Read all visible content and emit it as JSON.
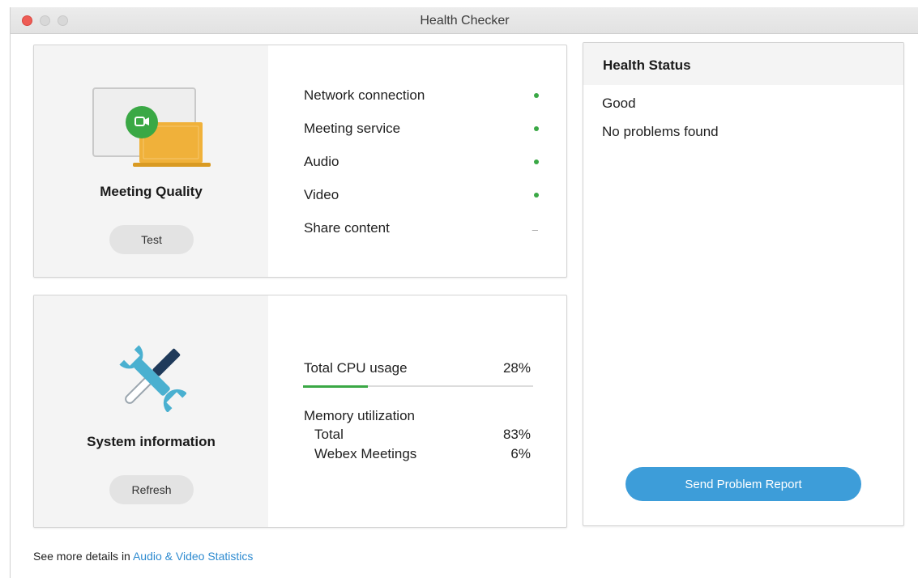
{
  "window": {
    "title": "Health Checker"
  },
  "meeting_quality": {
    "title": "Meeting Quality",
    "button_label": "Test",
    "checks": [
      {
        "label": "Network connection",
        "status": "ok"
      },
      {
        "label": "Meeting service",
        "status": "ok"
      },
      {
        "label": "Audio",
        "status": "ok"
      },
      {
        "label": "Video",
        "status": "ok"
      },
      {
        "label": "Share content",
        "status": "none",
        "status_text": "–"
      }
    ]
  },
  "system_info": {
    "title": "System information",
    "button_label": "Refresh",
    "cpu": {
      "label": "Total CPU usage",
      "value": "28%",
      "fraction": 0.28
    },
    "memory": {
      "heading": "Memory utilization",
      "total_label": "Total",
      "total_value": "83%",
      "app_label": "Webex Meetings",
      "app_value": "6%"
    }
  },
  "health_status": {
    "title": "Health Status",
    "status": "Good",
    "message": "No problems found",
    "button_label": "Send Problem Report"
  },
  "footer": {
    "prefix": "See more details in ",
    "link_label": "Audio & Video Statistics"
  },
  "colors": {
    "ok_green": "#3aa845",
    "accent_blue": "#3d9dd9",
    "link_blue": "#2e8bd0",
    "close_red": "#ee5c55",
    "laptop_orange": "#f0b13a",
    "wrench_teal": "#4ab0d0",
    "screwdriver_navy": "#1f3a5a"
  }
}
